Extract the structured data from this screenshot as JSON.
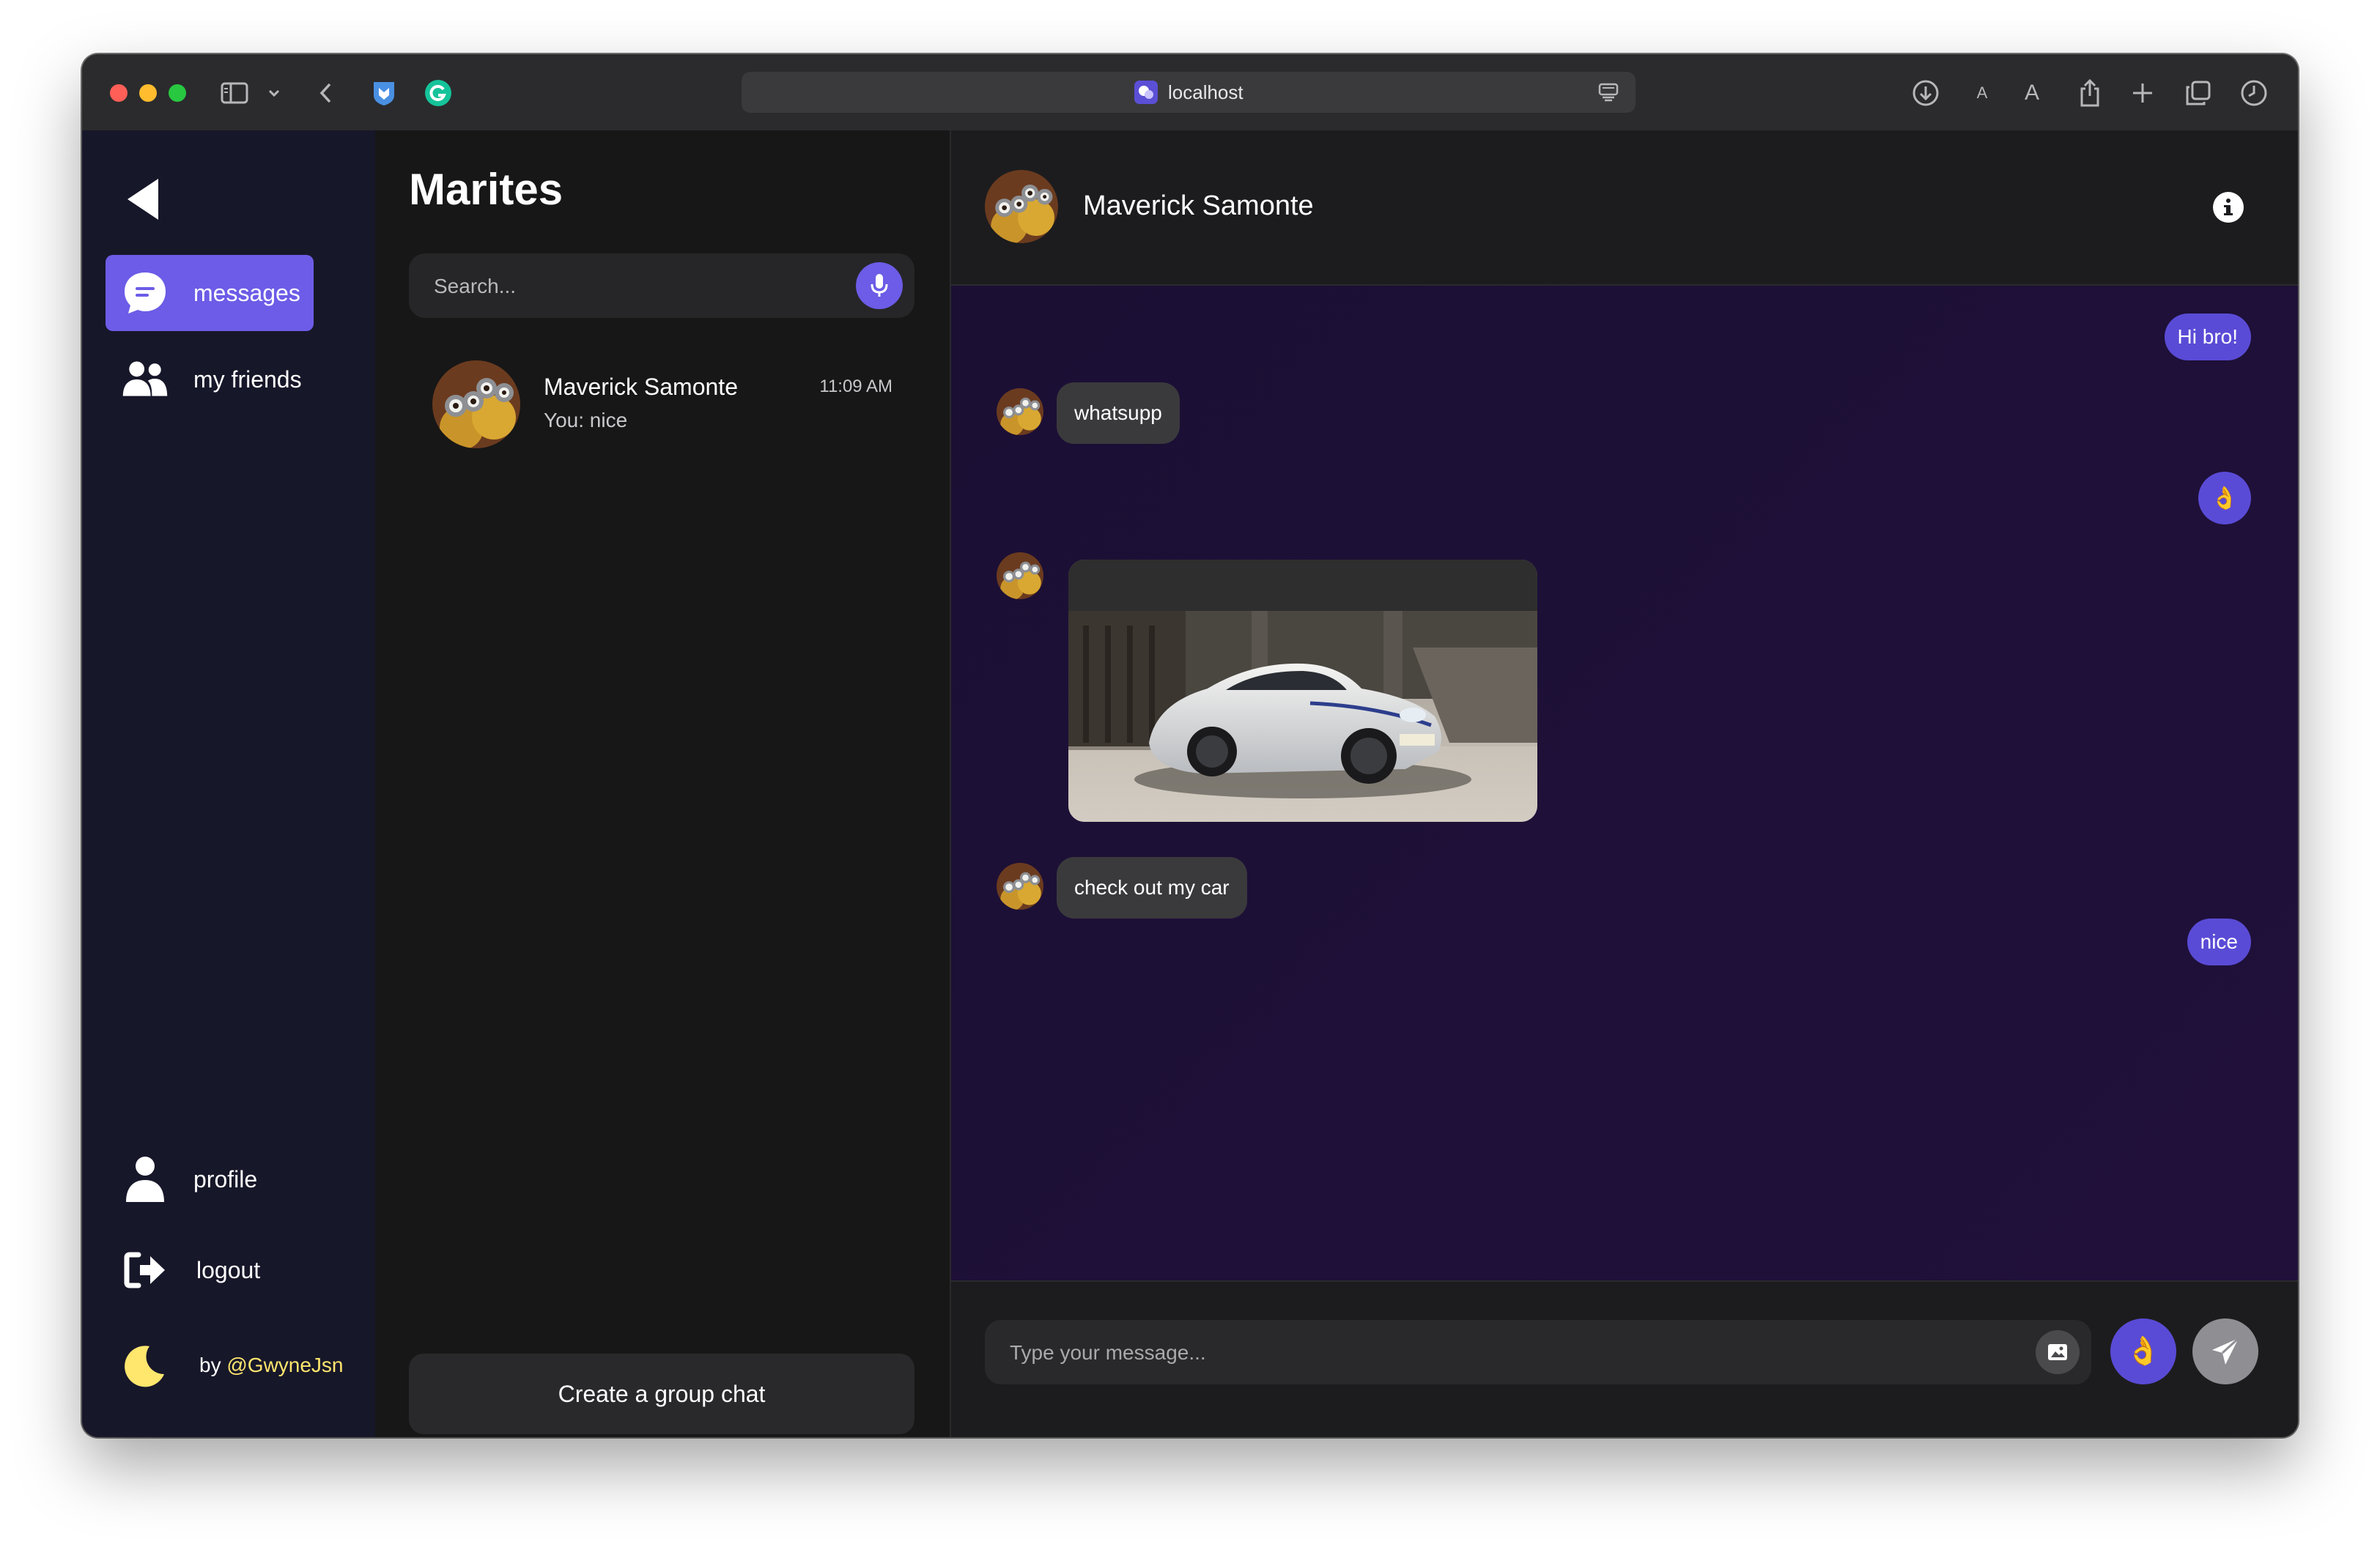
{
  "browser": {
    "url": "localhost",
    "icons": [
      "sidebar-toggle-icon",
      "chevron-down-icon",
      "back-arrow-icon",
      "extension-shield-icon",
      "grammarly-icon",
      "site-favicon",
      "reader-mode-icon",
      "download-icon",
      "text-smaller-icon",
      "text-larger-icon",
      "share-icon",
      "new-tab-icon",
      "tab-overview-icon",
      "history-clock-icon"
    ],
    "font_small": "A",
    "font_large": "A"
  },
  "sidebar": {
    "back_icon": "triangle-left-icon",
    "nav": [
      {
        "label": "messages",
        "icon": "chat-bubble-icon",
        "active": true
      },
      {
        "label": "my friends",
        "icon": "users-icon",
        "active": false
      }
    ],
    "bottom": [
      {
        "label": "profile",
        "icon": "person-icon"
      },
      {
        "label": "logout",
        "icon": "logout-icon"
      }
    ],
    "byline_prefix": "by ",
    "byline_handle": "@GwyneJsn",
    "theme_icon": "moon-icon"
  },
  "list": {
    "title": "Marites",
    "search_placeholder": "Search...",
    "conversations": [
      {
        "name": "Maverick Samonte",
        "preview": "You: nice",
        "time": "11:09 AM"
      }
    ],
    "group_button": "Create a group chat"
  },
  "chat": {
    "header_name": "Maverick Samonte",
    "messages": [
      {
        "from": "me",
        "type": "text",
        "text": "Hi bro!"
      },
      {
        "from": "them",
        "type": "text",
        "text": "whatsupp"
      },
      {
        "from": "me",
        "type": "emoji",
        "text": "👌"
      },
      {
        "from": "them",
        "type": "image",
        "alt": "white sports car"
      },
      {
        "from": "them",
        "type": "text",
        "text": "check out my car"
      },
      {
        "from": "me",
        "type": "text",
        "text": "nice"
      }
    ],
    "input_placeholder": "Type your message...",
    "quick_emoji": "👌"
  },
  "colors": {
    "accent": "#6c5ce7",
    "sidebar_bg": "#17172a",
    "chat_bg": "#1b0f34",
    "bubble_in": "#3a3a3c",
    "byline_handle": "#ffe66d"
  }
}
